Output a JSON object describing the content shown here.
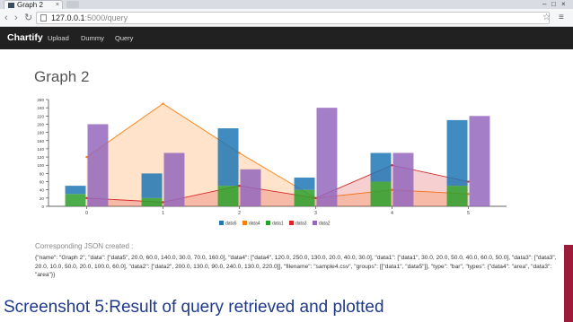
{
  "browser": {
    "tab_title": "Graph 2",
    "tab_close": "×",
    "url_host": "127.0.0.1",
    "url_path": ":5000/query",
    "back": "‹",
    "forward": "›",
    "reload": "↻",
    "bookmark": "☆",
    "menu": "≡"
  },
  "navbar": {
    "brand": "Chartify",
    "links": [
      "Upload",
      "Dummy",
      "Query"
    ]
  },
  "page": {
    "title": "Graph 2",
    "json_heading": "Corresponding JSON created :",
    "json_text": "{\"name\": \"Graph 2\", \"data\": [\"data5\", 20.0, 60.0, 140.0, 30.0, 70.0, 160.0], \"data4\": [\"data4\", 120.0, 250.0, 130.0, 20.0, 40.0, 30.0], \"data1\": [\"data1\", 30.0, 20.0, 50.0, 40.0, 60.0, 50.0], \"data3\": [\"data3\", 20.0, 10.0, 50.0, 20.0, 100.0, 60.0], \"data2\": [\"data2\", 200.0, 130.0, 90.0, 240.0, 130.0, 220.0]], \"filename\": \"sample4.csv\", \"groups\": [[\"data1\", \"data5\"]], \"type\": \"bar\", \"types\": {\"data4\": \"area\", \"data3\": \"area\"}}"
  },
  "caption": "Screenshot 5:Result of query retrieved and plotted",
  "chart_data": {
    "type": "bar",
    "categories": [
      "0",
      "1",
      "2",
      "3",
      "4",
      "5"
    ],
    "ylim": [
      0,
      260
    ],
    "yticks": [
      0,
      20,
      40,
      60,
      80,
      100,
      120,
      140,
      160,
      180,
      200,
      220,
      240,
      260
    ],
    "groups": [
      [
        "data1",
        "data5"
      ]
    ],
    "types": {
      "data4": "area",
      "data3": "area"
    },
    "series": [
      {
        "name": "data5",
        "type": "bar",
        "color": "#1f77b4",
        "values": [
          20,
          60,
          140,
          30,
          70,
          160
        ]
      },
      {
        "name": "data4",
        "type": "area",
        "color": "#ff7f0e",
        "values": [
          120,
          250,
          130,
          20,
          40,
          30
        ]
      },
      {
        "name": "data1",
        "type": "bar",
        "color": "#2ca02c",
        "values": [
          30,
          20,
          50,
          40,
          60,
          50
        ]
      },
      {
        "name": "data3",
        "type": "area",
        "color": "#d62728",
        "values": [
          20,
          10,
          50,
          20,
          100,
          60
        ]
      },
      {
        "name": "data2",
        "type": "bar",
        "color": "#9467bd",
        "values": [
          200,
          130,
          90,
          240,
          130,
          220
        ]
      }
    ],
    "legend": "bottom"
  }
}
